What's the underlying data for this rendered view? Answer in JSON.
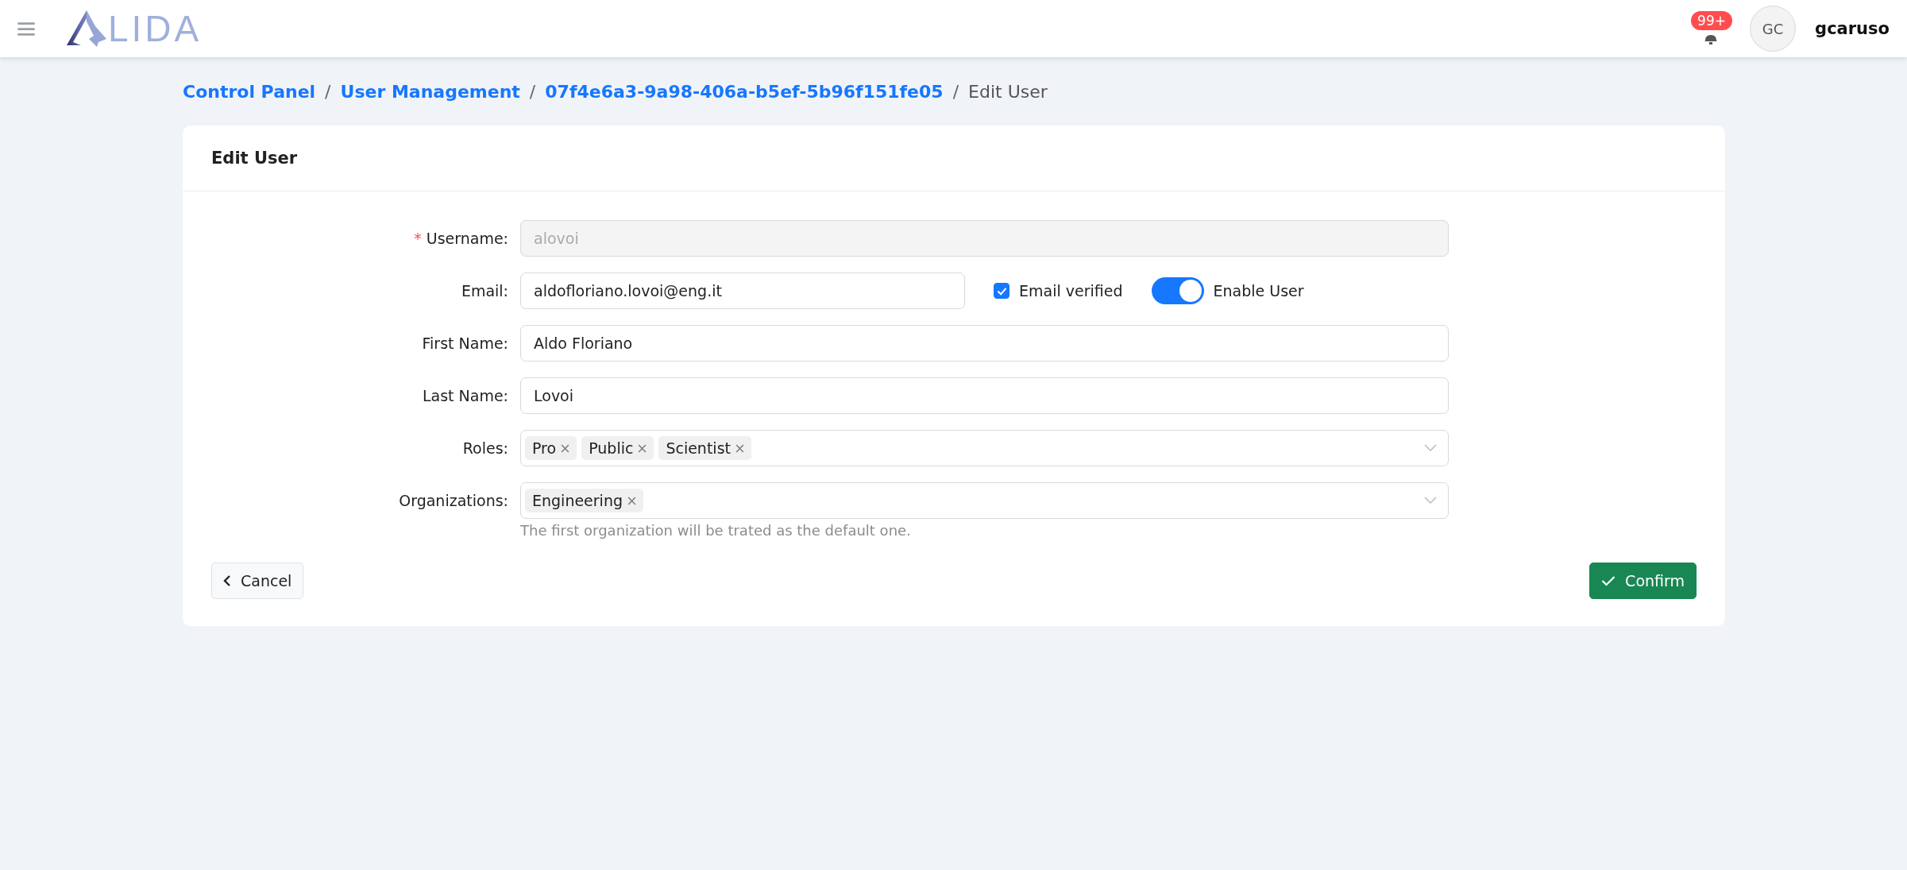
{
  "header": {
    "logo_text": "LIDA",
    "notifications": {
      "badge": "99+"
    },
    "avatar": {
      "initials": "GC"
    },
    "username": "gcaruso"
  },
  "breadcrumb": [
    {
      "label": "Control Panel",
      "link": true
    },
    {
      "label": "User Management",
      "link": true
    },
    {
      "label": "07f4e6a3-9a98-406a-b5ef-5b96f151fe05",
      "link": true
    },
    {
      "label": "Edit User",
      "link": false
    }
  ],
  "breadcrumb_separator": "/",
  "card": {
    "title": "Edit User"
  },
  "form": [
    {
      "kind": "text",
      "label": "Username:",
      "required_mark": "*",
      "value": "alovoi",
      "disabled": true
    },
    {
      "kind": "email",
      "label": "Email:",
      "value": "aldofloriano.lovoi@eng.it",
      "disabled": false,
      "checkbox": {
        "label": "Email verified",
        "checked": true
      },
      "switch": {
        "label": "Enable User",
        "on": true
      }
    },
    {
      "kind": "text",
      "label": "First Name:",
      "value": "Aldo Floriano",
      "disabled": false
    },
    {
      "kind": "text",
      "label": "Last Name:",
      "value": "Lovoi",
      "disabled": false
    },
    {
      "kind": "select",
      "label": "Roles:",
      "tags": [
        "Pro",
        "Public",
        "Scientist"
      ]
    },
    {
      "kind": "select",
      "label": "Organizations:",
      "tags": [
        "Engineering"
      ],
      "help": "The first organization will be trated as the default one."
    }
  ],
  "buttons": {
    "cancel": "Cancel",
    "confirm": "Confirm"
  }
}
